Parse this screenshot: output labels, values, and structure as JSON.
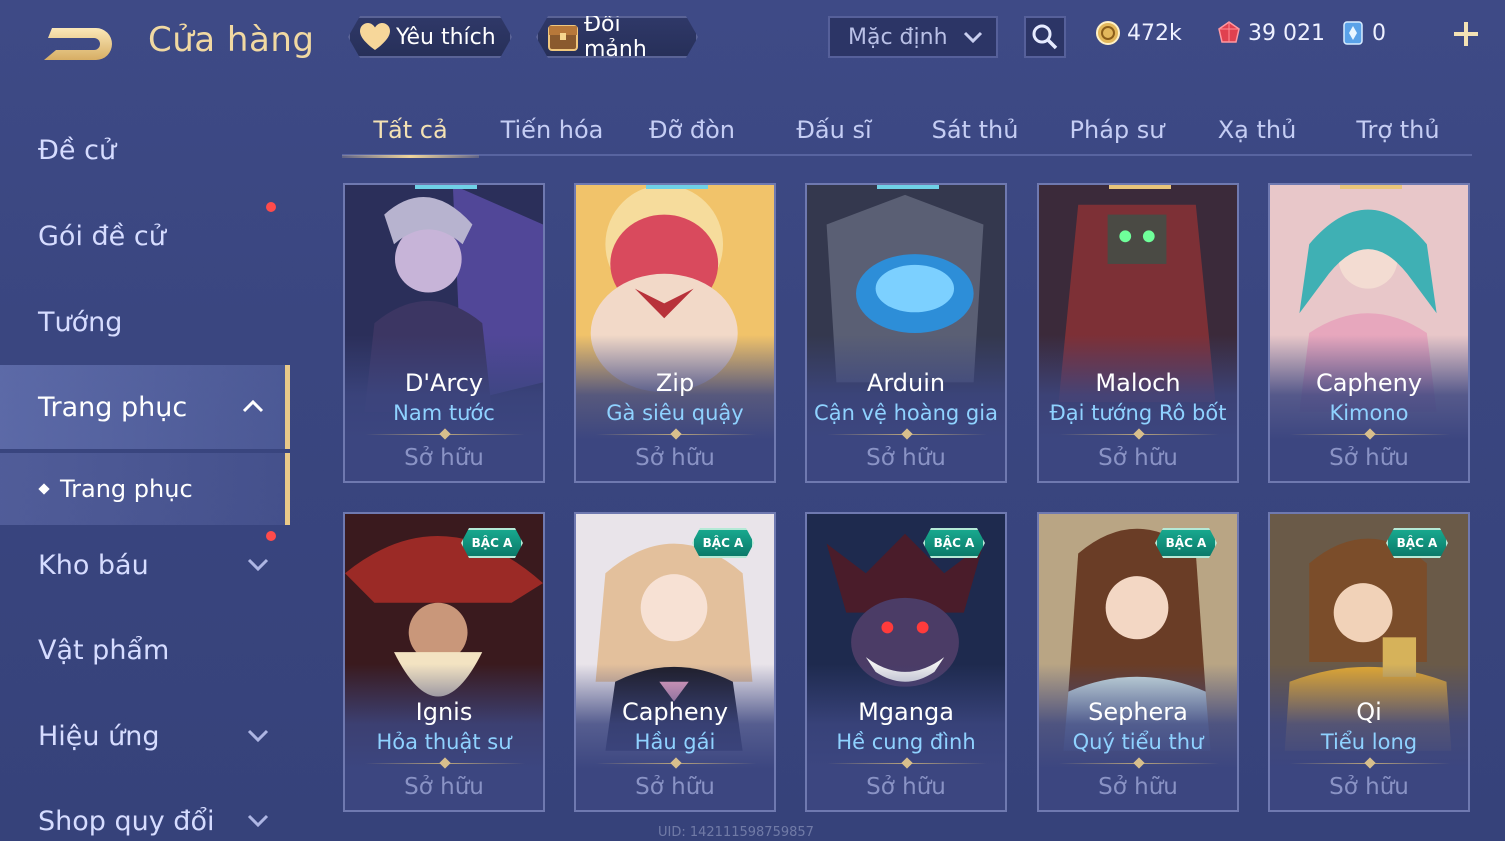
{
  "header": {
    "title": "Cửa hàng",
    "favorite_label": "Yêu thích",
    "exchange_label": "Đổi mảnh",
    "sort_selected": "Mặc định",
    "currency_gold": "472k",
    "currency_ruby": "39 021",
    "currency_card": "0"
  },
  "sidebar": {
    "items": [
      {
        "label": "Đề cử"
      },
      {
        "label": "Gói đề cử"
      },
      {
        "label": "Tướng"
      },
      {
        "label": "Trang phục"
      },
      {
        "label": "Kho báu"
      },
      {
        "label": "Vật phẩm"
      },
      {
        "label": "Hiệu ứng"
      },
      {
        "label": "Shop quy đổi"
      }
    ],
    "sub_item": "Trang phục"
  },
  "tabs": [
    "Tất cả",
    "Tiến hóa",
    "Đỡ đòn",
    "Đấu sĩ",
    "Sát thủ",
    "Pháp sư",
    "Xạ thủ",
    "Trợ thủ"
  ],
  "cards": [
    {
      "hero": "D'Arcy",
      "skin": "Nam tước",
      "status": "Sở hữu"
    },
    {
      "hero": "Zip",
      "skin": "Gà siêu quậy",
      "status": "Sở hữu"
    },
    {
      "hero": "Arduin",
      "skin": "Cận vệ hoàng gia",
      "status": "Sở hữu"
    },
    {
      "hero": "Maloch",
      "skin": "Đại tướng Rô bốt",
      "status": "Sở hữu"
    },
    {
      "hero": "Capheny",
      "skin": "Kimono",
      "status": "Sở hữu"
    },
    {
      "hero": "Ignis",
      "skin": "Hỏa thuật sư",
      "status": "Sở hữu",
      "badge": "BẬC A"
    },
    {
      "hero": "Capheny",
      "skin": "Hầu gái",
      "status": "Sở hữu",
      "badge": "BẬC A"
    },
    {
      "hero": "Mganga",
      "skin": "Hề cung đình",
      "status": "Sở hữu",
      "badge": "BẬC A"
    },
    {
      "hero": "Sephera",
      "skin": "Quý tiểu thư",
      "status": "Sở hữu",
      "badge": "BẬC A"
    },
    {
      "hero": "Qi",
      "skin": "Tiểu long",
      "status": "Sở hữu",
      "badge": "BẬC A"
    }
  ],
  "uid_text": "UID: 142111598759857",
  "colors": {
    "accent_gold": "#f1d9a2",
    "skin_name_blue": "#8fd2ff",
    "badge_green": "#18a88e",
    "notify_red": "#ff4b4b"
  }
}
